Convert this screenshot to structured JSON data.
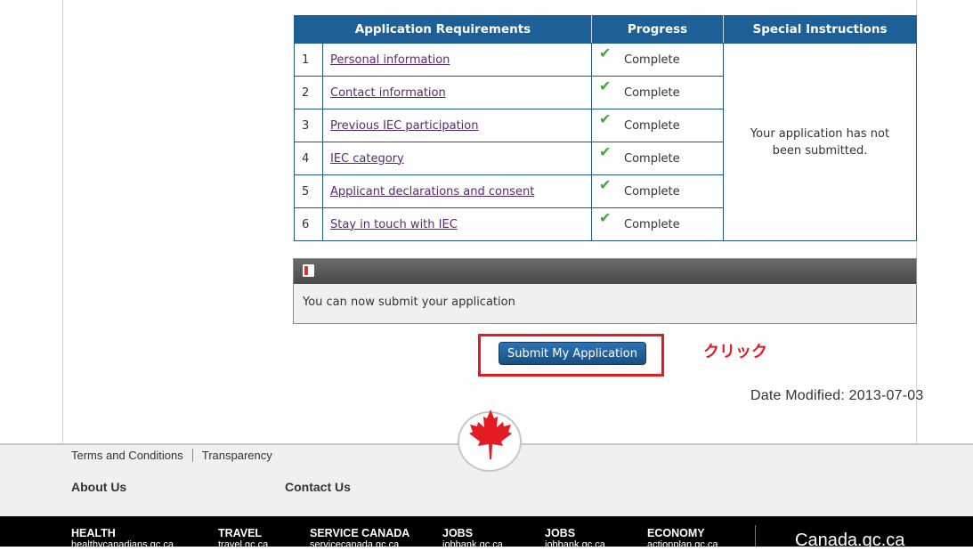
{
  "table": {
    "headers": [
      "Application Requirements",
      "Progress",
      "Special Instructions"
    ],
    "rows": [
      {
        "num": "1",
        "label": "Personal information",
        "status": "Complete"
      },
      {
        "num": "2",
        "label": "Contact information",
        "status": "Complete"
      },
      {
        "num": "3",
        "label": "Previous IEC participation",
        "status": "Complete"
      },
      {
        "num": "4",
        "label": "IEC category",
        "status": "Complete"
      },
      {
        "num": "5",
        "label": "Applicant declarations and consent",
        "status": "Complete"
      },
      {
        "num": "6",
        "label": "Stay in touch with IEC",
        "status": "Complete"
      }
    ],
    "special_line1": "Your application has not",
    "special_line2": "been submitted."
  },
  "notice": {
    "text": "You can now submit your application"
  },
  "submit": {
    "label": "Submit My Application",
    "annotation": "クリック"
  },
  "date_modified": "Date Modified: 2013-07-03",
  "footer": {
    "links": [
      "Terms and Conditions",
      "Transparency"
    ],
    "about": "About Us",
    "contact": "Contact Us",
    "bottom_items": [
      {
        "title": "HEALTH",
        "sub": "healthycanadians.gc.ca"
      },
      {
        "title": "TRAVEL",
        "sub": "travel.gc.ca"
      },
      {
        "title": "SERVICE CANADA",
        "sub": "servicecanada.gc.ca"
      },
      {
        "title": "JOBS",
        "sub": "jobbank.gc.ca"
      },
      {
        "title": "JOBS",
        "sub": "jobbank.gc.ca"
      },
      {
        "title": "ECONOMY",
        "sub": "actionplan.gc.ca"
      }
    ],
    "brand": "Canada.gc.ca"
  },
  "colors": {
    "header_blue": "#1d5f97",
    "check_green": "#3fa836",
    "annotation_red": "#e41b23",
    "maple_red": "#e41b23"
  }
}
